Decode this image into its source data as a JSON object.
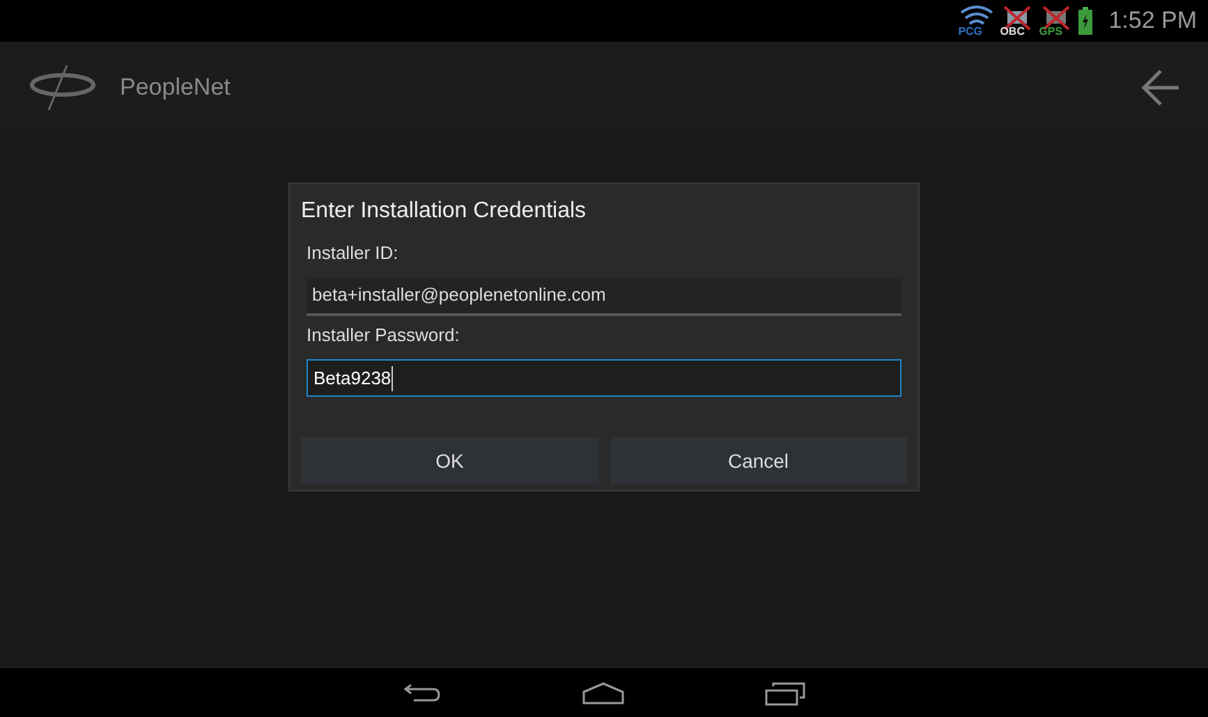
{
  "status_bar": {
    "icons": [
      {
        "kind": "wifi",
        "label": "PCG",
        "disabled": false
      },
      {
        "kind": "obc",
        "label": "OBC",
        "disabled": true
      },
      {
        "kind": "gps",
        "label": "GPS",
        "disabled": true
      },
      {
        "kind": "battery"
      }
    ],
    "time": "1:52 PM"
  },
  "app_bar": {
    "title": "PeopleNet"
  },
  "dialog": {
    "title": "Enter Installation Credentials",
    "fields": [
      {
        "label": "Installer ID:",
        "value": "beta+installer@peoplenetonline.com",
        "focused": false
      },
      {
        "label": "Installer Password:",
        "value": "Beta9238",
        "focused": true
      }
    ],
    "buttons": [
      "OK",
      "Cancel"
    ]
  }
}
